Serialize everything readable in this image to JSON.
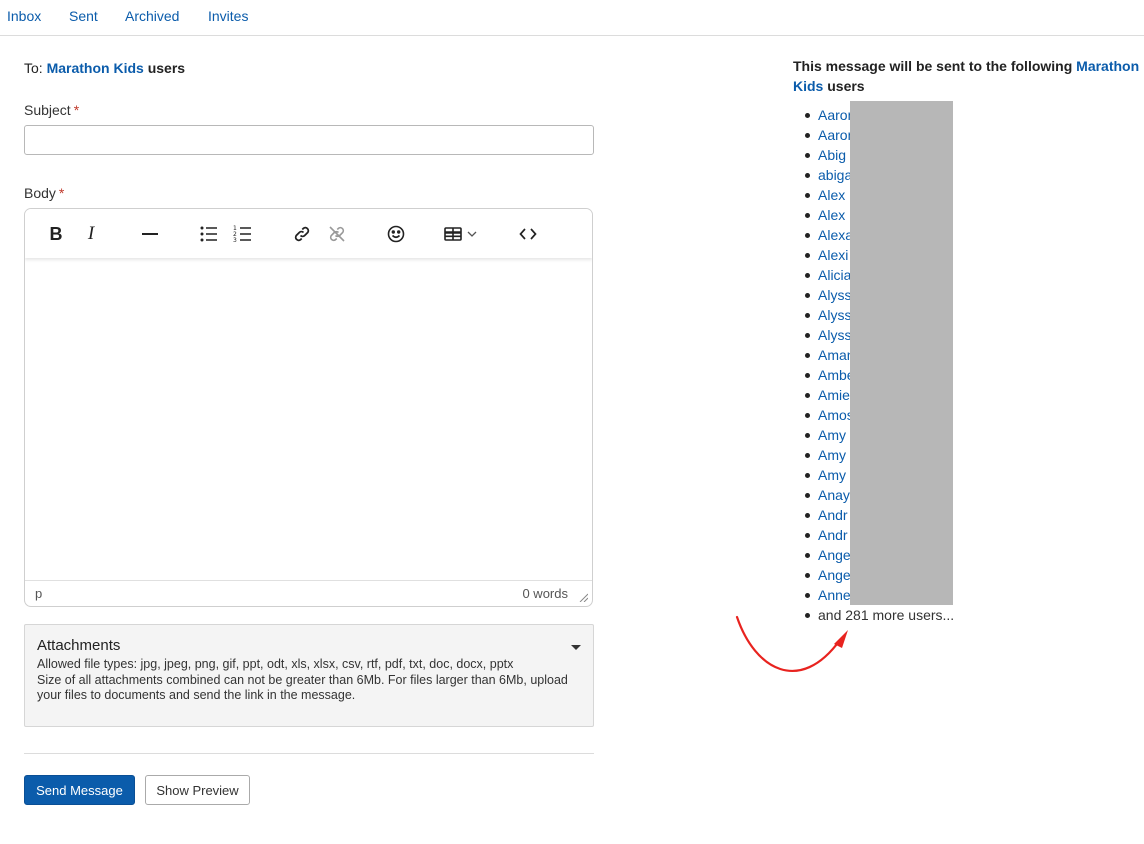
{
  "nav": {
    "items": [
      "Inbox",
      "Sent",
      "Archived",
      "Invites"
    ]
  },
  "to": {
    "prefix": "To:",
    "group": "Marathon Kids",
    "suffix": "users"
  },
  "subject": {
    "label": "Subject",
    "required_mark": "*",
    "value": "",
    "placeholder": ""
  },
  "body": {
    "label": "Body",
    "required_mark": "*",
    "toolbar": [
      {
        "name": "bold-icon",
        "glyph": "B"
      },
      {
        "name": "italic-icon",
        "glyph": "I"
      },
      {
        "name": "horizontal-rule-icon",
        "glyph": "—"
      },
      {
        "name": "bullet-list-icon",
        "glyph": "ul"
      },
      {
        "name": "numbered-list-icon",
        "glyph": "ol"
      },
      {
        "name": "link-icon",
        "glyph": "link"
      },
      {
        "name": "unlink-icon",
        "glyph": "unlink"
      },
      {
        "name": "emoji-icon",
        "glyph": "emoji"
      },
      {
        "name": "table-icon",
        "glyph": "table"
      },
      {
        "name": "source-code-icon",
        "glyph": "code"
      }
    ],
    "status_path": "p",
    "word_count": "0 words"
  },
  "attachments": {
    "title": "Attachments",
    "allowed": "Allowed file types: jpg, jpeg, png, gif, ppt, odt, xls, xlsx, csv, rtf, pdf, txt, doc, docx, pptx",
    "size_note_1": "Size of all attachments combined can not be greater than 6Mb. For files larger than 6Mb, upload",
    "size_note_2": "your files to documents and send the link in the message."
  },
  "buttons": {
    "send": "Send Message",
    "preview": "Show Preview"
  },
  "recipients": {
    "heading_pre": "This message will be sent to the following",
    "heading_group": "Marathon Kids",
    "heading_post": "users",
    "users": [
      "Aaron",
      "Aaron",
      "Abig",
      "abiga",
      "Alex",
      "Alex",
      "Alexa",
      "Alexi",
      "Alicia",
      "Alyss",
      "Alyss",
      "Alyss",
      "Aman",
      "Ambe",
      "Amie",
      "Amos",
      "Amy",
      "Amy",
      "Amy",
      "Anay",
      "Andr",
      "Andr",
      "Ange",
      "Ange",
      "Anne"
    ],
    "more": "and 281 more users..."
  },
  "colors": {
    "link": "#0b5cab",
    "required": "#c0392b",
    "annotation_arrow": "#e8231f",
    "redaction": "#b7b7b7"
  }
}
